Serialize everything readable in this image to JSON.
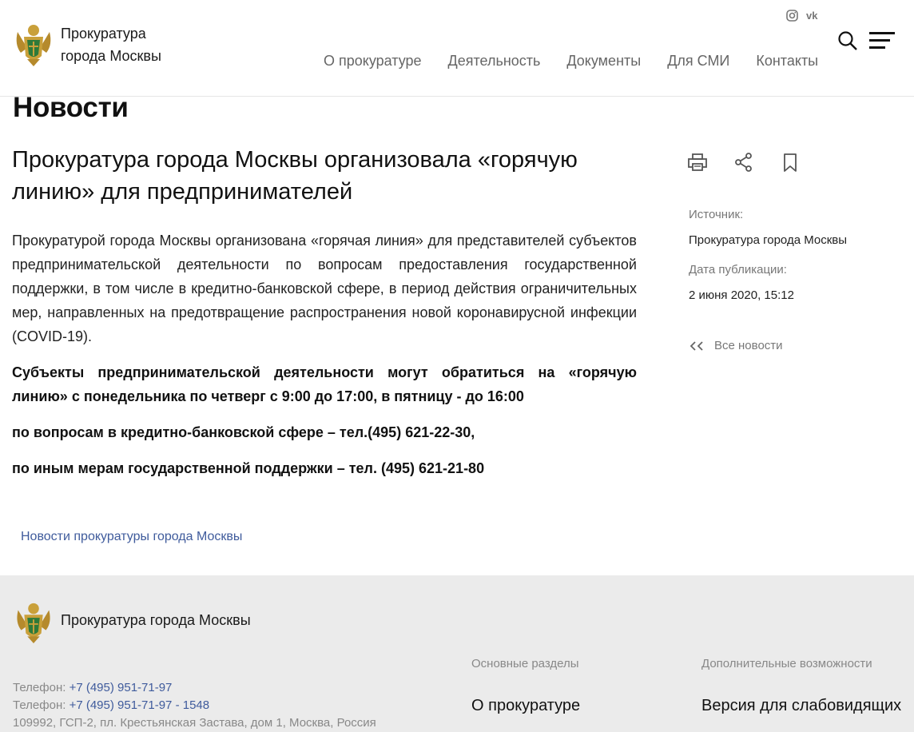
{
  "header": {
    "site_name_line1": "Прокуратура",
    "site_name_line2": "города Москвы",
    "social": [
      "instagram-icon",
      "vk-icon"
    ],
    "nav": [
      "О прокуратуре",
      "Деятельность",
      "Документы",
      "Для СМИ",
      "Контакты"
    ]
  },
  "section_title": "Новости",
  "article": {
    "title": "Прокуратура города Москвы организовала «горячую линию» для предпринимателей",
    "p1": "Прокуратурой города Москвы организована «горячая линия» для представителей субъектов предпринимательской деятельности по вопросам предоставления государственной поддержки, в том числе в кредитно-банковской сфере, в период действия ограничительных мер, направленных на предотвращение распространения новой коронавирусной инфекции (COVID-19).",
    "p2": "Субъекты предпринимательской деятельности могут обратиться на «горячую линию» с понедельника по четверг с 9:00 до 17:00, в пятницу - до 16:00",
    "p3": "по вопросам в кредитно-банковской сфере –  тел.(495) 621-22-30,",
    "p4": "по иным мерам государственной поддержки – тел. (495) 621-21-80",
    "tag_link": "Новости прокуратуры города Москвы"
  },
  "sidebar": {
    "source_label": "Источник:",
    "source_value": "Прокуратура города Москвы",
    "date_label": "Дата публикации:",
    "date_value": "2 июня 2020, 15:12",
    "back_link": "Все новости"
  },
  "footer": {
    "name": "Прокуратура города Москвы",
    "phone_label_1": "Телефон: ",
    "phone_1": "+7 (495) 951-71-97",
    "phone_label_2": "Телефон: ",
    "phone_2": "+7 (495) 951-71-97 - 1548",
    "address": "109992, ГСП-2, пл. Крестьянская Застава, дом 1, Москва, Россия",
    "col1_title": "Основные разделы",
    "col1_link": "О прокуратуре",
    "col2_title": "Дополнительные возможности",
    "col2_link": "Версия для слабовидящих"
  },
  "colors": {
    "link": "#3f5b9c",
    "footer_bg": "#ebebeb",
    "muted": "#777777"
  }
}
